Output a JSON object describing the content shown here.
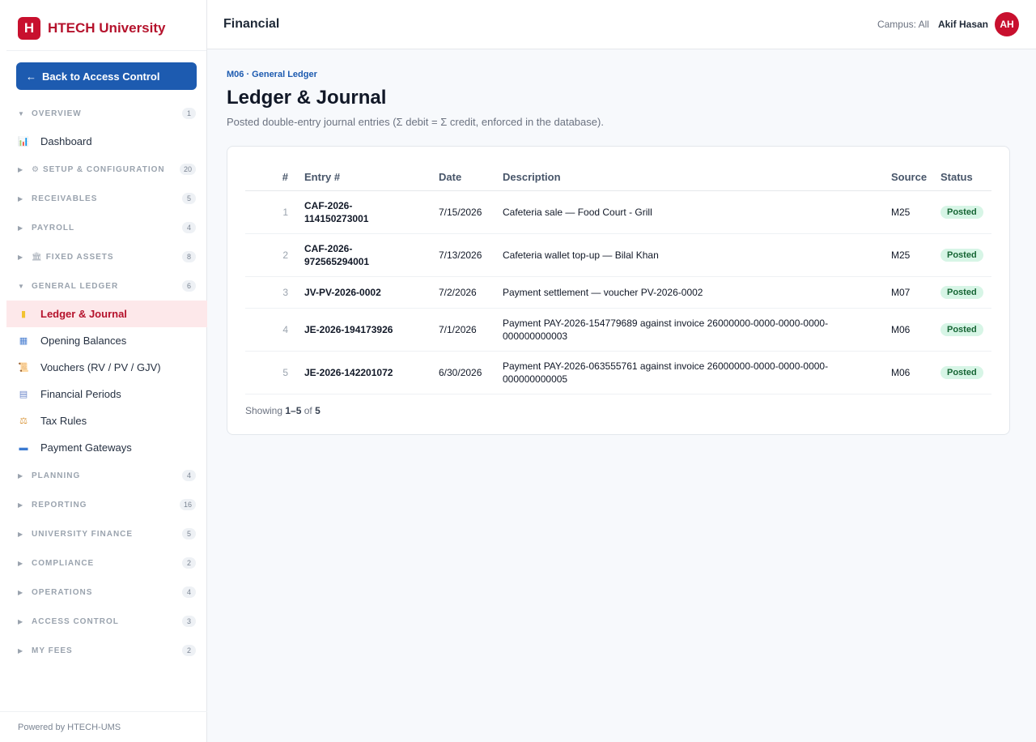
{
  "brand": {
    "logo_letter": "H",
    "name": "HTECH University",
    "accent": "#c8102e"
  },
  "sidebar": {
    "back_label": "Back to Access Control",
    "sections": [
      {
        "title": "OVERVIEW",
        "count": "1",
        "expanded": true,
        "icon": "",
        "items": [
          {
            "label": "Dashboard",
            "icon": "chart-icon"
          }
        ]
      },
      {
        "title": "SETUP & CONFIGURATION",
        "count": "20",
        "expanded": false,
        "icon": "gear-icon",
        "items": []
      },
      {
        "title": "RECEIVABLES",
        "count": "5",
        "expanded": false,
        "icon": "",
        "items": []
      },
      {
        "title": "PAYROLL",
        "count": "4",
        "expanded": false,
        "icon": "",
        "items": []
      },
      {
        "title": "FIXED ASSETS",
        "count": "8",
        "expanded": false,
        "icon": "bank-icon",
        "items": []
      },
      {
        "title": "GENERAL LEDGER",
        "count": "6",
        "expanded": true,
        "icon": "",
        "items": [
          {
            "label": "Ledger & Journal",
            "icon": "ledger-icon",
            "active": true
          },
          {
            "label": "Opening Balances",
            "icon": "abacus-icon"
          },
          {
            "label": "Vouchers (RV / PV / GJV)",
            "icon": "scroll-icon"
          },
          {
            "label": "Financial Periods",
            "icon": "calendar-icon"
          },
          {
            "label": "Tax Rules",
            "icon": "scales-icon"
          },
          {
            "label": "Payment Gateways",
            "icon": "card-icon"
          }
        ]
      },
      {
        "title": "PLANNING",
        "count": "4",
        "expanded": false,
        "icon": "",
        "items": []
      },
      {
        "title": "REPORTING",
        "count": "16",
        "expanded": false,
        "icon": "",
        "items": []
      },
      {
        "title": "UNIVERSITY FINANCE",
        "count": "5",
        "expanded": false,
        "icon": "",
        "items": []
      },
      {
        "title": "COMPLIANCE",
        "count": "2",
        "expanded": false,
        "icon": "",
        "items": []
      },
      {
        "title": "OPERATIONS",
        "count": "4",
        "expanded": false,
        "icon": "",
        "items": []
      },
      {
        "title": "ACCESS CONTROL",
        "count": "3",
        "expanded": false,
        "icon": "",
        "items": []
      },
      {
        "title": "MY FEES",
        "count": "2",
        "expanded": false,
        "icon": "",
        "items": []
      }
    ],
    "footer": "Powered by HTECH-UMS"
  },
  "topbar": {
    "title": "Financial",
    "campus": "Campus: All",
    "user_name": "Akif Hasan",
    "avatar_initials": "AH"
  },
  "main": {
    "breadcrumb": "M06 · General Ledger",
    "title": "Ledger & Journal",
    "subtitle": "Posted double-entry journal entries (Σ debit = Σ credit, enforced in the database).",
    "table": {
      "columns": [
        "#",
        "Entry #",
        "Date",
        "Description",
        "Source",
        "Status"
      ],
      "rows": [
        {
          "num": "1",
          "entry": "CAF-2026-114150273001",
          "entry_lines": [
            "CAF-2026-",
            "114150273001"
          ],
          "date": "7/15/2026",
          "description": "Cafeteria sale — Food Court - Grill",
          "source": "M25",
          "status": "Posted"
        },
        {
          "num": "2",
          "entry": "CAF-2026-972565294001",
          "entry_lines": [
            "CAF-2026-",
            "972565294001"
          ],
          "date": "7/13/2026",
          "description": "Cafeteria wallet top-up — Bilal Khan",
          "source": "M25",
          "status": "Posted"
        },
        {
          "num": "3",
          "entry": "JV-PV-2026-0002",
          "entry_lines": [
            "JV-PV-2026-0002"
          ],
          "date": "7/2/2026",
          "description": "Payment settlement — voucher PV-2026-0002",
          "source": "M07",
          "status": "Posted"
        },
        {
          "num": "4",
          "entry": "JE-2026-194173926",
          "entry_lines": [
            "JE-2026-194173926"
          ],
          "date": "7/1/2026",
          "description": "Payment PAY-2026-154779689 against invoice 26000000-0000-0000-0000-000000000003",
          "source": "M06",
          "status": "Posted"
        },
        {
          "num": "5",
          "entry": "JE-2026-142201072",
          "entry_lines": [
            "JE-2026-142201072"
          ],
          "date": "6/30/2026",
          "description": "Payment PAY-2026-063555761 against invoice 26000000-0000-0000-0000-000000000005",
          "source": "M06",
          "status": "Posted"
        }
      ]
    },
    "showing": {
      "prefix": "Showing ",
      "range": "1–5",
      "of": " of ",
      "total": "5"
    }
  }
}
